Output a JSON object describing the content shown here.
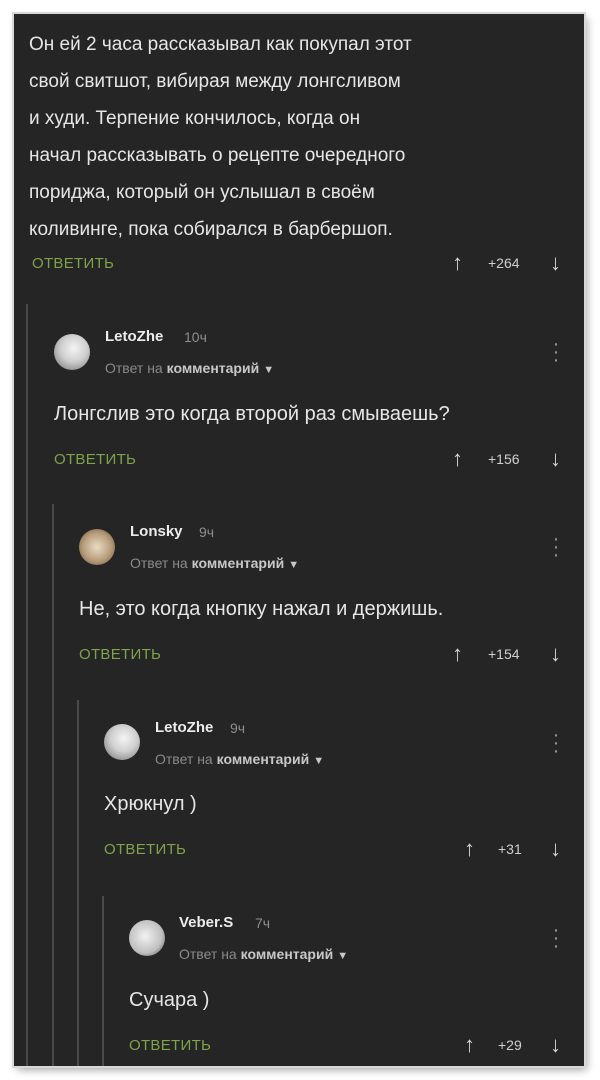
{
  "main_comment": {
    "lines": [
      "Он ей 2 часа рассказывал как покупал этот",
      "свой свитшот, вибирая между лонгсливом",
      "и худи. Терпение кончилось, когда он",
      "начал рассказывать о рецепте очередного",
      "пориджа, который он услышал в своём",
      "коливинге, пока собирался в барбершоп."
    ],
    "reply_label": "ОТВЕТИТЬ",
    "score": "+264"
  },
  "replies": [
    {
      "author": "LetoZhe",
      "time": "10ч",
      "reply_prefix": "Ответ на",
      "reply_target": "комментарий",
      "text": "Лонгслив это когда второй раз смываешь?",
      "reply_label": "ОТВЕТИТЬ",
      "score": "+156"
    },
    {
      "author": "Lonsky",
      "time": "9ч",
      "reply_prefix": "Ответ на",
      "reply_target": "комментарий",
      "text": "Не, это когда кнопку нажал и держишь.",
      "reply_label": "ОТВЕТИТЬ",
      "score": "+154"
    },
    {
      "author": "LetoZhe",
      "time": "9ч",
      "reply_prefix": "Ответ на",
      "reply_target": "комментарий",
      "text": "Хрюкнул )",
      "reply_label": "ОТВЕТИТЬ",
      "score": "+31"
    },
    {
      "author": "Veber.S",
      "time": "7ч",
      "reply_prefix": "Ответ на",
      "reply_target": "комментарий",
      "text": "Сучара )",
      "reply_label": "ОТВЕТИТЬ",
      "score": "+29"
    }
  ],
  "icons": {
    "upvote": "up-arrow-icon",
    "downvote": "down-arrow-icon",
    "more": "more-vertical-icon",
    "dropdown": "chevron-down-icon"
  },
  "colors": {
    "background": "#252525",
    "reply_link": "#7fa34a",
    "text": "#e6e6e6"
  }
}
